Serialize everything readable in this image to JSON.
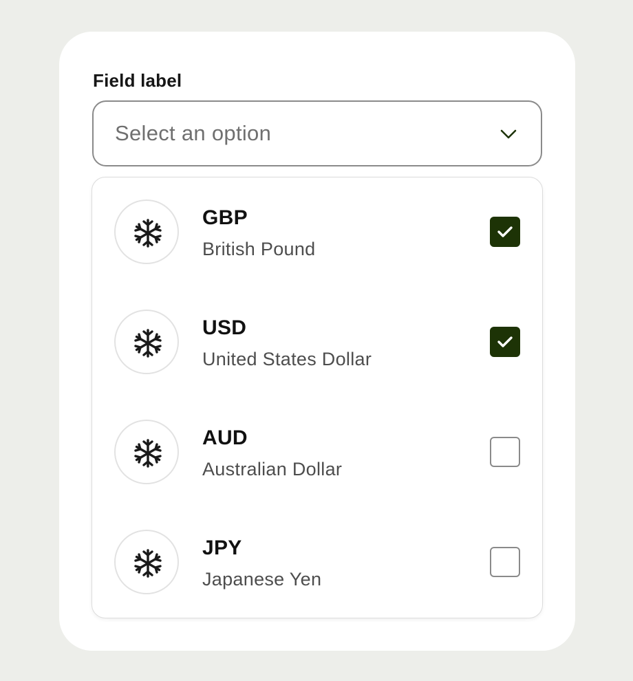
{
  "field": {
    "label": "Field label",
    "placeholder": "Select an option",
    "chevron_icon": "chevron-down-icon"
  },
  "options": [
    {
      "code": "GBP",
      "name": "British Pound",
      "icon": "snowflake-icon",
      "checked": true
    },
    {
      "code": "USD",
      "name": "United States Dollar",
      "icon": "snowflake-icon",
      "checked": true
    },
    {
      "code": "AUD",
      "name": "Australian Dollar",
      "icon": "snowflake-icon",
      "checked": false
    },
    {
      "code": "JPY",
      "name": "Japanese Yen",
      "icon": "snowflake-icon",
      "checked": false
    }
  ],
  "colors": {
    "accent": "#1d3306",
    "background": "#edeeea",
    "card": "#ffffff"
  }
}
